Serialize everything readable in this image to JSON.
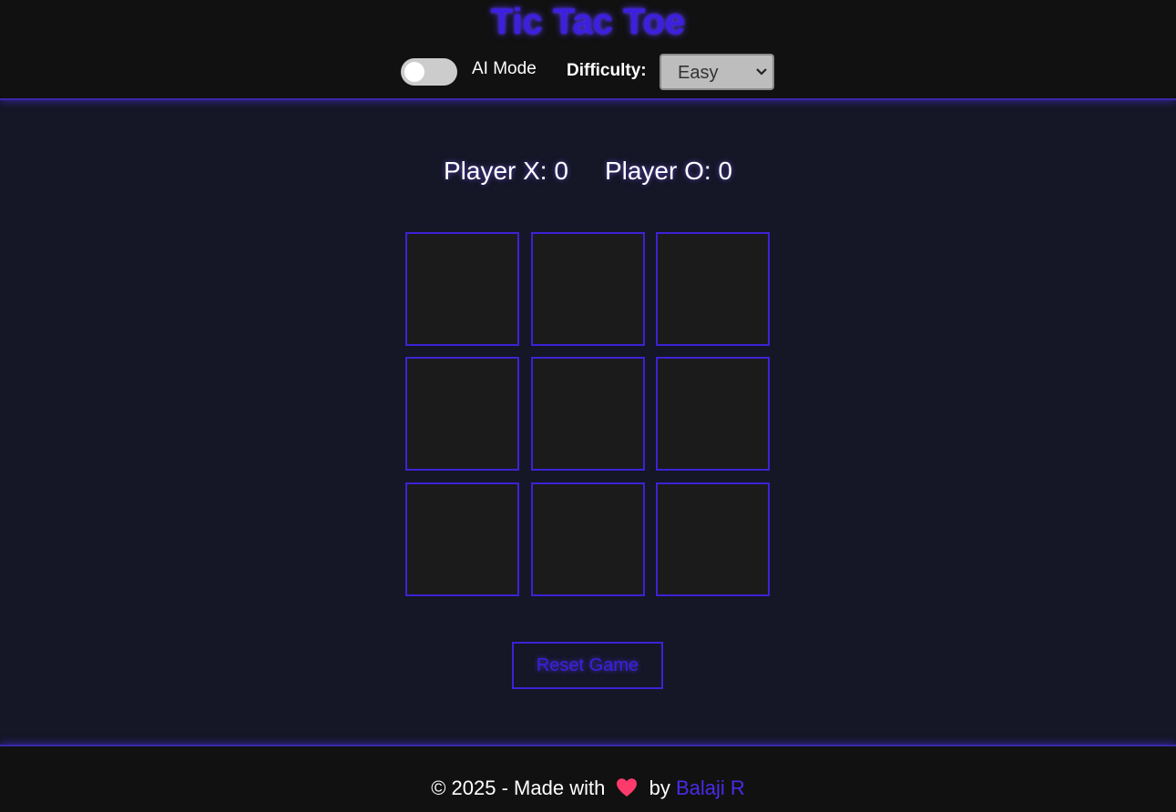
{
  "header": {
    "title": "Tic Tac Toe",
    "ai_mode_label": "AI Mode",
    "ai_mode_enabled": false,
    "difficulty_label": "Difficulty:",
    "difficulty_value": "Easy"
  },
  "scoreboard": {
    "player_x": "Player X: 0",
    "player_o": "Player O: 0"
  },
  "board": {
    "cells": [
      "",
      "",
      "",
      "",
      "",
      "",
      "",
      "",
      ""
    ]
  },
  "reset_label": "Reset Game",
  "footer": {
    "prefix": "© 2025 - Made with",
    "by": "by",
    "author": "Balaji R",
    "heart_icon": "heart-icon"
  },
  "colors": {
    "accent": "#3d22d6",
    "background": "#151626",
    "bar_background": "#111111",
    "cell_background": "#1b1b1b",
    "heart": "#ff3b6b"
  }
}
